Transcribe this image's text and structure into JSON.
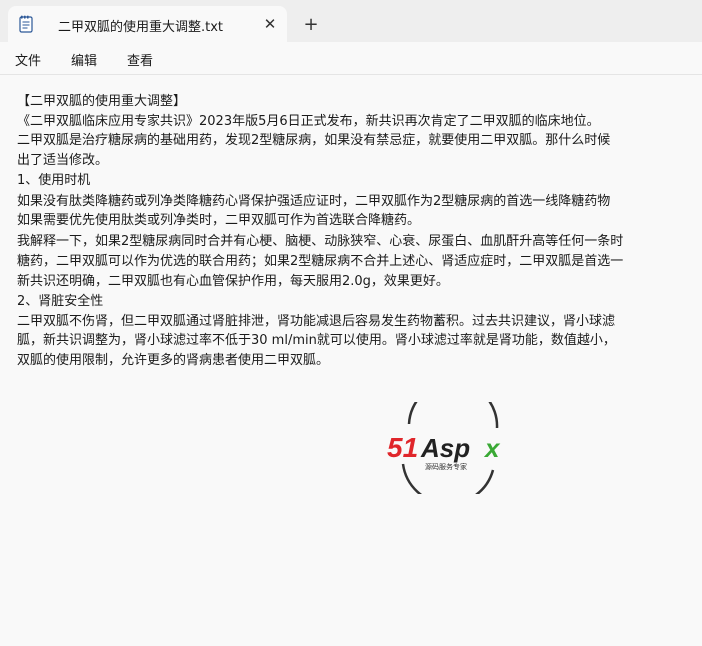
{
  "tab": {
    "title": "二甲双胍的使用重大调整.txt",
    "close_glyph": "✕",
    "new_tab_glyph": "+",
    "icon": "notepad-icon"
  },
  "menu": {
    "file": "文件",
    "edit": "编辑",
    "view": "查看"
  },
  "document": {
    "lines": [
      "【二甲双胍的使用重大调整】",
      "《二甲双胍临床应用专家共识》2023年版5月6日正式发布，新共识再次肯定了二甲双胍的临床地位。",
      "二甲双胍是治疗糖尿病的基础用药，发现2型糖尿病，如果没有禁忌症，就要使用二甲双胍。那什么时候",
      "出了适当修改。",
      "1、使用时机",
      "如果没有肽类降糖药或列净类降糖药心肾保护强适应证时，二甲双胍作为2型糖尿病的首选一线降糖药物",
      "如果需要优先使用肽类或列净类时，二甲双胍可作为首选联合降糖药。",
      "我解释一下，如果2型糖尿病同时合并有心梗、脑梗、动脉狭窄、心衰、尿蛋白、血肌酐升高等任何一条时",
      "糖药，二甲双胍可以作为优选的联合用药；如果2型糖尿病不合并上述心、肾适应症时，二甲双胍是首选一",
      "新共识还明确，二甲双胍也有心血管保护作用，每天服用2.0g，效果更好。",
      "2、肾脏安全性",
      "二甲双胍不伤肾，但二甲双胍通过肾脏排泄，肾功能减退后容易发生药物蓄积。过去共识建议，肾小球滤",
      "胍，新共识调整为，肾小球滤过率不低于30 ml/min就可以使用。肾小球滤过率就是肾功能，数值越小，",
      "双胍的使用限制，允许更多的肾病患者使用二甲双胍。"
    ]
  },
  "watermark": {
    "brand": "51Aspx",
    "tagline": "源码服务专家",
    "brand_color_red": "#e0262b",
    "brand_color_dark": "#222222",
    "brand_color_green": "#3aa935"
  }
}
